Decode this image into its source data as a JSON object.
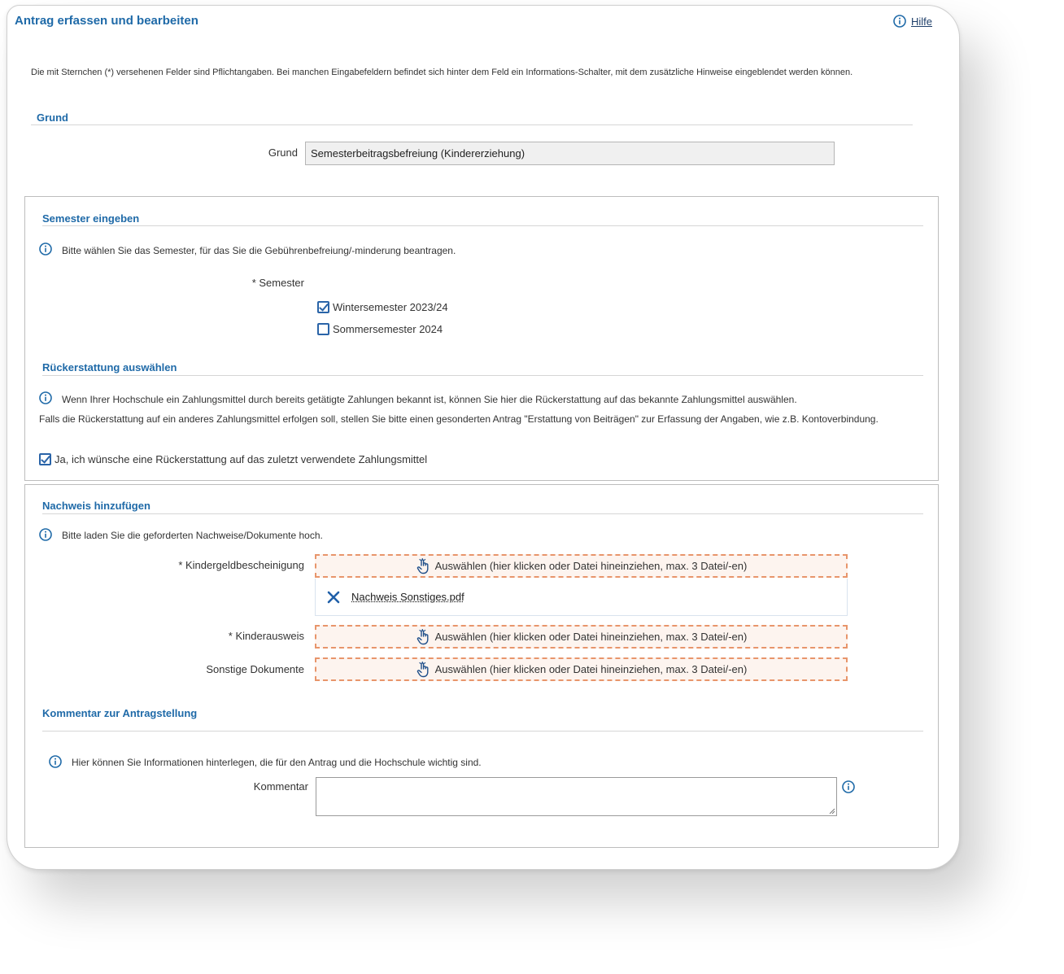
{
  "header": {
    "title": "Antrag erfassen und bearbeiten",
    "help_label": "Hilfe"
  },
  "intro": "Die mit Sternchen (*) versehenen Felder sind Pflichtangaben. Bei manchen Eingabefeldern befindet sich hinter dem Feld ein Informations-Schalter, mit dem zusätzliche Hinweise eingeblendet werden können.",
  "grund": {
    "heading": "Grund",
    "label": "Grund",
    "value": "Semesterbeitragsbefreiung (Kindererziehung)"
  },
  "semester": {
    "heading": "Semester eingeben",
    "info": "Bitte wählen Sie das Semester, für das Sie die Gebührenbefreiung/-minderung beantragen.",
    "label": "* Semester",
    "options": [
      {
        "label": "Wintersemester 2023/24",
        "checked": true
      },
      {
        "label": "Sommersemester 2024",
        "checked": false
      }
    ]
  },
  "refund": {
    "heading": "Rückerstattung auswählen",
    "info": "Wenn Ihrer Hochschule ein Zahlungsmittel durch bereits getätigte Zahlungen bekannt ist, können Sie hier die Rückerstattung auf das bekannte Zahlungsmittel auswählen.",
    "note": "Falls die Rückerstattung auf ein anderes Zahlungsmittel erfolgen soll, stellen Sie bitte einen gesonderten Antrag \"Erstattung von Beiträgen\" zur Erfassung der Angaben, wie z.B. Kontoverbindung.",
    "checkbox_label": "Ja, ich wünsche eine Rückerstattung auf das zuletzt verwendete Zahlungsmittel",
    "checked": true
  },
  "proof": {
    "heading": "Nachweis hinzufügen",
    "info": "Bitte laden Sie die geforderten Nachweise/Dokumente hoch.",
    "upload_text": "Auswählen (hier klicken oder Datei hineinziehen, max. 3 Datei/-en)",
    "fields": [
      {
        "label": "* Kindergeldbescheinigung"
      },
      {
        "label": "* Kinderausweis"
      },
      {
        "label": "Sonstige Dokumente"
      }
    ],
    "uploaded_file": "Nachweis Sonstiges.pdf"
  },
  "comment": {
    "heading": "Kommentar zur Antragstellung",
    "info": "Hier können Sie Informationen hinterlegen, die für den Antrag und die Hochschule wichtig sind.",
    "label": "Kommentar",
    "value": ""
  },
  "colors": {
    "accent": "#1f6aa8",
    "dropzone_border": "#e8956b",
    "dropzone_bg": "#fdf4ef"
  },
  "icons": {
    "info": "info-circle-icon",
    "upload": "hand-pointer-icon",
    "remove": "close-icon"
  }
}
